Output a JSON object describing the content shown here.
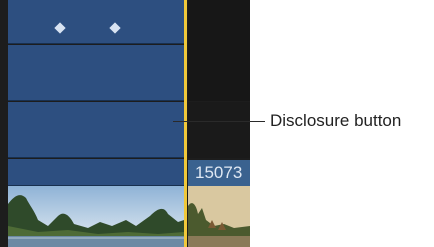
{
  "timeline": {
    "clip_name": "15073",
    "keyframe_count": 2
  },
  "callout": {
    "label": "Disclosure button"
  },
  "colors": {
    "lane": "#2d4f80",
    "playhead": "#f0c83a",
    "clip_label_bg": "#3a628f"
  },
  "icons": {
    "keyframe": "diamond-icon",
    "disclosure": "disclosure-triangle-icon"
  }
}
